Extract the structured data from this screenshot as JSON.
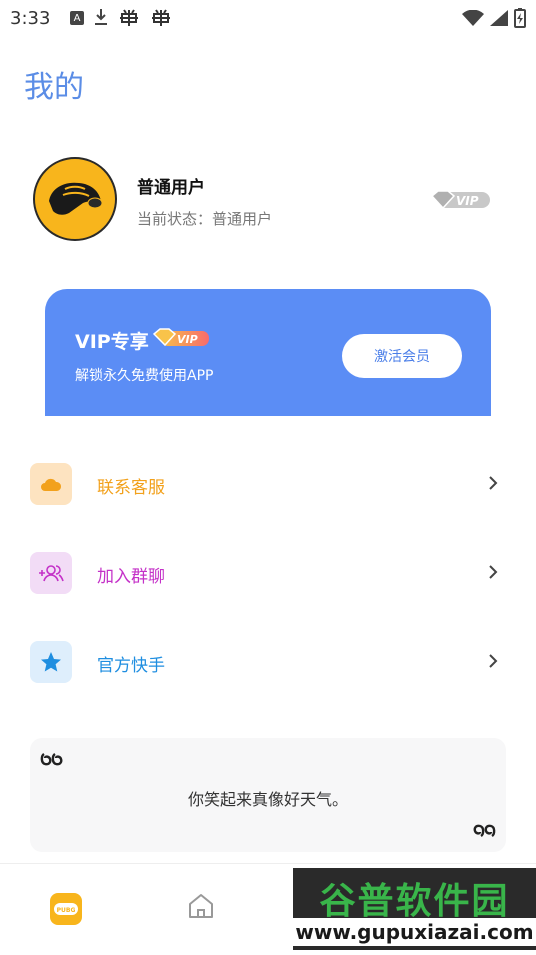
{
  "status_bar": {
    "time": "3:33",
    "icons_left": [
      "a-icon",
      "download-icon",
      "bug-icon",
      "bug-icon"
    ],
    "icons_right": [
      "wifi-icon",
      "signal-icon",
      "battery-icon"
    ]
  },
  "page": {
    "title": "我的"
  },
  "profile": {
    "name": "普通用户",
    "status_label": "当前状态：",
    "status_value": "普通用户",
    "badge": "VIP"
  },
  "vip_card": {
    "title": "VIP专享",
    "subtitle": "解锁永久免费使用APP",
    "button": "激活会员",
    "background": "#5b8df5"
  },
  "menu": [
    {
      "label": "联系客服",
      "icon": "cloud-icon",
      "color": "#f2a11c",
      "bg": "#fde3c0"
    },
    {
      "label": "加入群聊",
      "icon": "add-group-icon",
      "color": "#c431c8",
      "bg": "#f2dcf6"
    },
    {
      "label": "官方快手",
      "icon": "star-icon",
      "color": "#1f8ee0",
      "bg": "#deeefc"
    }
  ],
  "quote": {
    "text": "你笑起来真像好天气。"
  },
  "bottom_nav": {
    "items": [
      {
        "icon": "pubg-icon",
        "active": true
      },
      {
        "icon": "home-icon",
        "active": false
      }
    ]
  },
  "watermark": {
    "top": "谷普软件园",
    "bottom": "www.gupuxiazai.com"
  }
}
